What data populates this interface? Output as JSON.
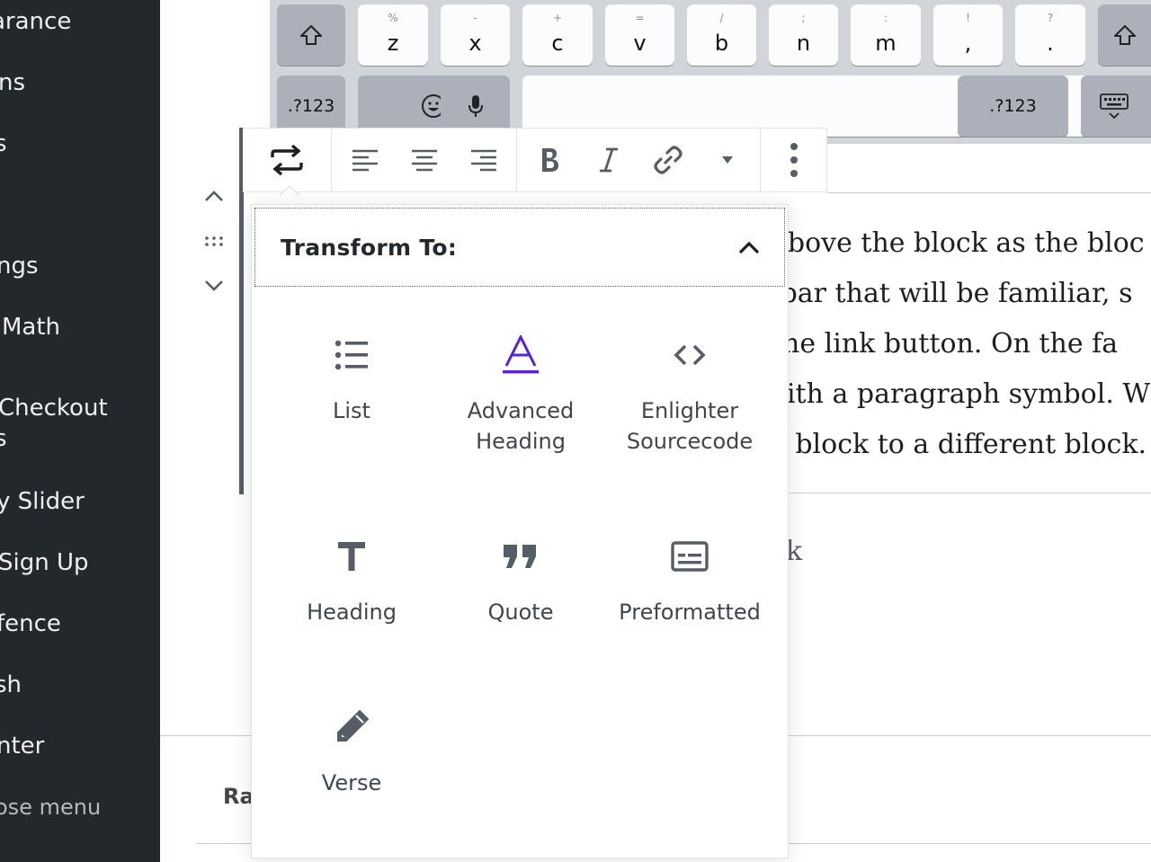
{
  "sidebar": {
    "items": [
      {
        "label": "arance"
      },
      {
        "label": "ns"
      },
      {
        "label": "s"
      },
      {
        "label": "ngs"
      },
      {
        "label": "Math"
      },
      {
        "label": "Checkout"
      },
      {
        "label": "s"
      },
      {
        "label": "y Slider"
      },
      {
        "label": "Sign Up"
      },
      {
        "label": "fence"
      },
      {
        "label": "sh"
      },
      {
        "label": "nter"
      },
      {
        "label": "ose menu"
      }
    ]
  },
  "keyboard": {
    "row3": [
      {
        "hint": "%",
        "main": "z"
      },
      {
        "hint": "-",
        "main": "x"
      },
      {
        "hint": "+",
        "main": "c"
      },
      {
        "hint": "=",
        "main": "v"
      },
      {
        "hint": "/",
        "main": "b"
      },
      {
        "hint": ";",
        "main": "n"
      },
      {
        "hint": ":",
        "main": "m"
      },
      {
        "hint": "!",
        "main": ","
      },
      {
        "hint": "?",
        "main": "."
      }
    ],
    "numbers_left": ".?123",
    "numbers_right": ".?123"
  },
  "editor": {
    "lines": [
      "above the block as the bloc",
      "lbar that will be familiar, s",
      " the link button.  On the fa",
      "vith a paragraph symbol.  W",
      "c block to a different block."
    ],
    "placeholder_fragment": "k",
    "footer_fragment": "Ra"
  },
  "popover": {
    "title": "Transform To:",
    "items": [
      {
        "label": "List",
        "icon": "list-icon"
      },
      {
        "label": "Advanced Heading",
        "icon": "advanced-heading-icon"
      },
      {
        "label": "Enlighter Sourcecode",
        "icon": "code-icon"
      },
      {
        "label": "Heading",
        "icon": "heading-icon"
      },
      {
        "label": "Quote",
        "icon": "quote-icon"
      },
      {
        "label": "Preformatted",
        "icon": "preformatted-icon"
      },
      {
        "label": "Verse",
        "icon": "verse-icon"
      }
    ]
  },
  "colors": {
    "sidebar_bg": "#23282d",
    "accent_purple": "#5b20d8",
    "icon_gray": "#555d66"
  }
}
